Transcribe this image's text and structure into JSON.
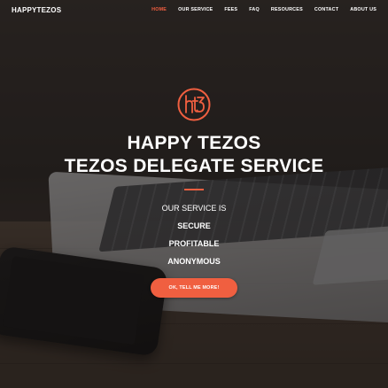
{
  "brand": "HAPPYTEZOS",
  "nav": {
    "items": [
      {
        "label": "HOME",
        "active": true
      },
      {
        "label": "OUR SERVICE",
        "active": false
      },
      {
        "label": "FEES",
        "active": false
      },
      {
        "label": "FAQ",
        "active": false
      },
      {
        "label": "RESOURCES",
        "active": false
      },
      {
        "label": "CONTACT",
        "active": false
      },
      {
        "label": "ABOUT US",
        "active": false
      }
    ]
  },
  "hero": {
    "logo_icon": "happytezos-logo-icon",
    "title_line1": "HAPPY TEZOS",
    "title_line2": "TEZOS DELEGATE SERVICE",
    "intro": "OUR SERVICE IS",
    "features": [
      "SECURE",
      "PROFITABLE",
      "ANONYMOUS"
    ],
    "cta_label": "OK, TELL ME MORE!"
  },
  "colors": {
    "accent": "#f05f40",
    "text": "#ffffff"
  }
}
